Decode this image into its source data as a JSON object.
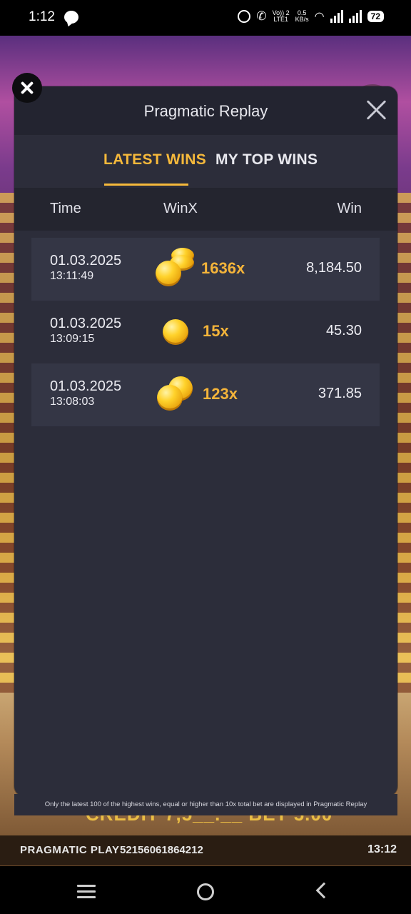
{
  "status_bar": {
    "time": "1:12",
    "network_speed": "0.5",
    "network_unit": "KB/s",
    "volte_line1": "Vo)) 2",
    "volte_line2": "LTE1",
    "battery": "72"
  },
  "game": {
    "brand": "PRAGMATIC PLAY",
    "round_id": "52156061864212",
    "clock": "13:12",
    "credit_partial": "CREDIT 7,5__.__   BET 5.00"
  },
  "modal": {
    "title": "Pragmatic Replay",
    "tabs": [
      {
        "label": "LATEST WINS",
        "active": true
      },
      {
        "label": "MY TOP WINS",
        "active": false
      }
    ],
    "columns": {
      "time": "Time",
      "winx": "WinX",
      "win": "Win"
    },
    "rows": [
      {
        "date": "01.03.2025",
        "time": "13:11:49",
        "multiplier": "1636x",
        "win": "8,184.50",
        "coins": "coin-stack-icon"
      },
      {
        "date": "01.03.2025",
        "time": "13:09:15",
        "multiplier": "15x",
        "win": "45.30",
        "coins": "single-coin-icon"
      },
      {
        "date": "01.03.2025",
        "time": "13:08:03",
        "multiplier": "123x",
        "win": "371.85",
        "coins": "double-coin-icon"
      }
    ],
    "disclaimer": "Only the latest 100 of the highest wins, equal or higher than 10x total bet are displayed in Pragmatic Replay"
  },
  "colors": {
    "accent": "#f6b93b",
    "modal_bg": "#2c2d3a",
    "row_shade": "#343645"
  }
}
